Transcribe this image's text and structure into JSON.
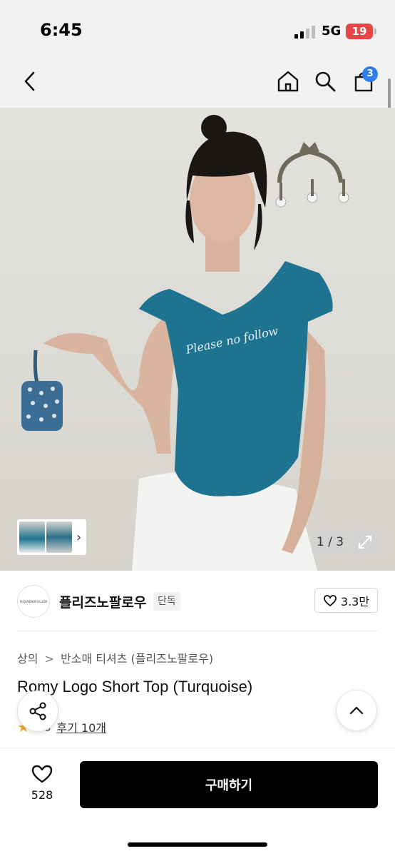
{
  "status_bar": {
    "time": "6:45",
    "network": "5G",
    "battery": "19"
  },
  "nav": {
    "cart_count": "3"
  },
  "hero": {
    "page_indicator": "1 / 3",
    "shirt_text": "Please no follow"
  },
  "brand": {
    "logo_text": "PLEASENOFOLLOW",
    "name": "플리즈노팔로우",
    "tag": "단독",
    "likes": "3.3만"
  },
  "breadcrumb": [
    "상의",
    "반소매 티셔츠 (플리즈노팔로우)"
  ],
  "product": {
    "title": "Romy Logo Short Top (Turquoise)",
    "rating": "4.8",
    "reviews": "후기 10개"
  },
  "bottom": {
    "wish_count": "528",
    "buy_label": "구매하기"
  },
  "colors": {
    "accent": "#2f7ff0",
    "buy_bg": "#000000",
    "shirt": "#1e7391",
    "star": "#f5a623"
  },
  "icons": [
    "back-icon",
    "home-icon",
    "search-icon",
    "bag-icon",
    "share-icon",
    "chevron-up-icon",
    "heart-icon",
    "expand-icon",
    "chevron-right-icon"
  ]
}
